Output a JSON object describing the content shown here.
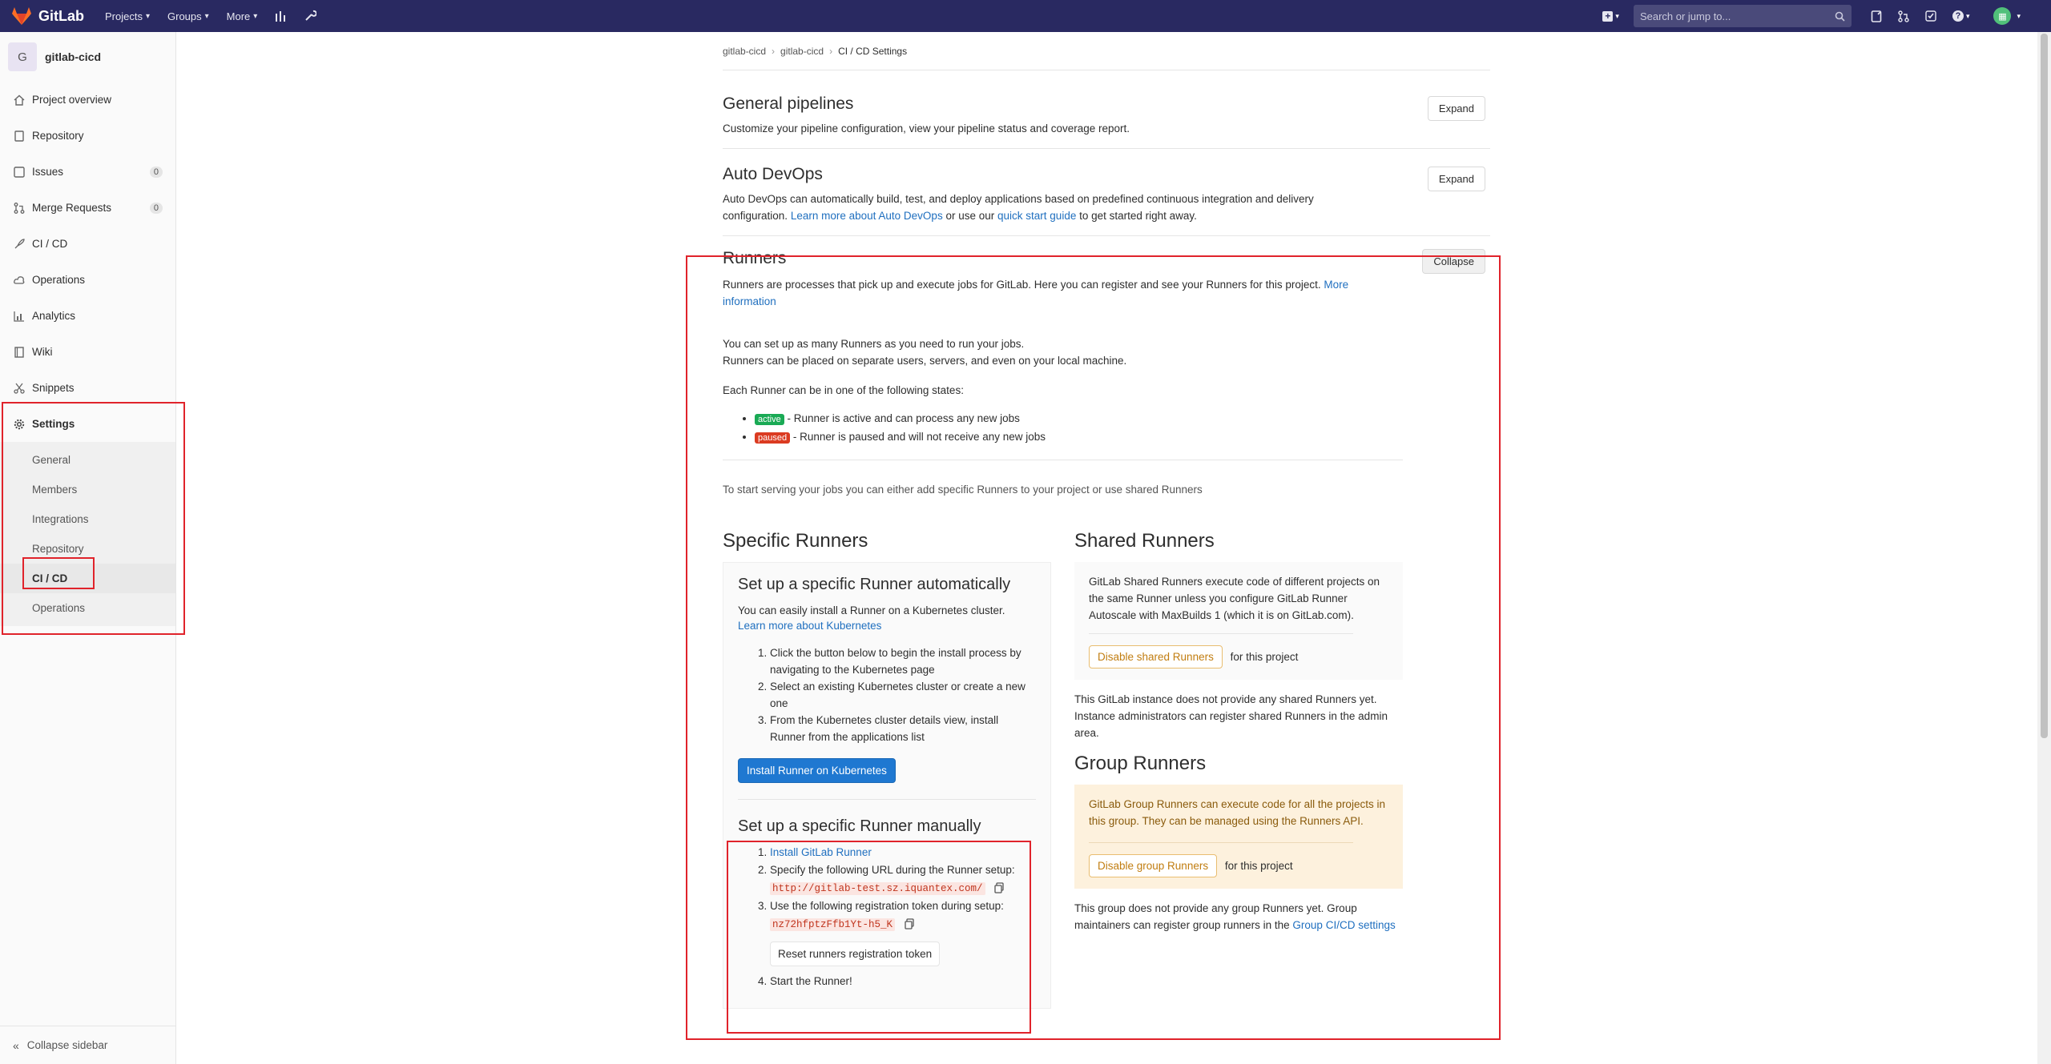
{
  "navbar": {
    "brand": "GitLab",
    "menu": [
      {
        "label": "Projects"
      },
      {
        "label": "Groups"
      },
      {
        "label": "More"
      }
    ],
    "search_placeholder": "Search or jump to..."
  },
  "sidebar": {
    "project_initial": "G",
    "project_name": "gitlab-cicd",
    "items": [
      {
        "label": "Project overview",
        "icon": "home-icon"
      },
      {
        "label": "Repository",
        "icon": "doc-icon"
      },
      {
        "label": "Issues",
        "icon": "issues-icon",
        "badge": "0"
      },
      {
        "label": "Merge Requests",
        "icon": "merge-request-icon",
        "badge": "0"
      },
      {
        "label": "CI / CD",
        "icon": "rocket-icon"
      },
      {
        "label": "Operations",
        "icon": "cloud-icon"
      },
      {
        "label": "Analytics",
        "icon": "chart-icon"
      },
      {
        "label": "Wiki",
        "icon": "book-icon"
      },
      {
        "label": "Snippets",
        "icon": "scissors-icon"
      },
      {
        "label": "Settings",
        "icon": "gear-icon"
      }
    ],
    "settings_sub": [
      "General",
      "Members",
      "Integrations",
      "Repository",
      "CI / CD",
      "Operations"
    ],
    "collapse_label": "Collapse sidebar"
  },
  "breadcrumb": [
    "gitlab-cicd",
    "gitlab-cicd",
    "CI / CD Settings"
  ],
  "general_pipelines": {
    "title": "General pipelines",
    "desc": "Customize your pipeline configuration, view your pipeline status and coverage report.",
    "button": "Expand"
  },
  "auto_devops": {
    "title": "Auto DevOps",
    "desc_1": "Auto DevOps can automatically build, test, and deploy applications based on predefined continuous integration and delivery configuration.",
    "link_1": "Learn more about Auto DevOps",
    "desc_2": "or use our",
    "link_2": "quick start guide",
    "desc_3": "to get started right away.",
    "button": "Expand"
  },
  "runners": {
    "title": "Runners",
    "button": "Collapse",
    "intro": "Runners are processes that pick up and execute jobs for GitLab. Here you can register and see your Runners for this project.",
    "intro_link": "More information",
    "para_1": "You can set up as many Runners as you need to run your jobs.",
    "para_2": "Runners can be placed on separate users, servers, and even on your local machine.",
    "states_intro": "Each Runner can be in one of the following states:",
    "state_active_label": "active",
    "state_active_desc": "- Runner is active and can process any new jobs",
    "state_paused_label": "paused",
    "state_paused_desc": "- Runner is paused and will not receive any new jobs",
    "lead": "To start serving your jobs you can either add specific Runners to your project or use shared Runners"
  },
  "specific": {
    "title": "Specific Runners",
    "auto_title": "Set up a specific Runner automatically",
    "auto_desc": "You can easily install a Runner on a Kubernetes cluster.",
    "auto_link": "Learn more about Kubernetes",
    "auto_steps": [
      "Click the button below to begin the install process by navigating to the Kubernetes page",
      "Select an existing Kubernetes cluster or create a new one",
      "From the Kubernetes cluster details view, install Runner from the applications list"
    ],
    "install_button": "Install Runner on Kubernetes",
    "manual_title": "Set up a specific Runner manually",
    "manual_step_1": "Install GitLab Runner",
    "manual_step_2": "Specify the following URL during the Runner setup:",
    "url": "http://gitlab-test.sz.iquantex.com/",
    "manual_step_3": "Use the following registration token during setup:",
    "token": "nz72hfptzFfb1Yt-h5_K",
    "reset_button": "Reset runners registration token",
    "manual_step_4": "Start the Runner!"
  },
  "shared": {
    "title": "Shared Runners",
    "desc": "GitLab Shared Runners execute code of different projects on the same Runner unless you configure GitLab Runner Autoscale with MaxBuilds 1 (which it is on GitLab.com).",
    "button": "Disable shared Runners",
    "button_suffix": "for this project",
    "note": "This GitLab instance does not provide any shared Runners yet. Instance administrators can register shared Runners in the admin area."
  },
  "group": {
    "title": "Group Runners",
    "desc": "GitLab Group Runners can execute code for all the projects in this group. They can be managed using the Runners API.",
    "button": "Disable group Runners",
    "button_suffix": "for this project",
    "note": "This group does not provide any group Runners yet. Group maintainers can register group runners in the",
    "note_link": "Group CI/CD settings"
  },
  "colors": {
    "navbar": "#292961",
    "link": "#1f6fbf",
    "primary": "#1f78d1",
    "highlight": "#e0232b"
  }
}
